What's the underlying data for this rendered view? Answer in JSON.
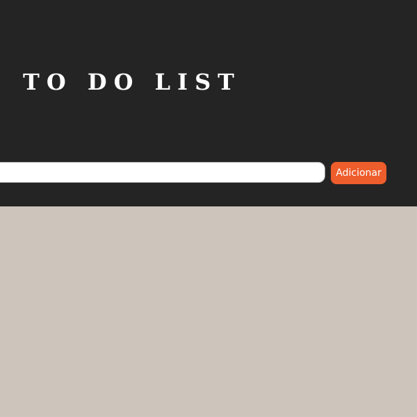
{
  "header": {
    "title": "TO DO LIST"
  },
  "form": {
    "task_input_value": "",
    "task_input_placeholder": "",
    "add_button_label": "Adicionar"
  },
  "tasks": [],
  "colors": {
    "header_background": "#252424",
    "page_background": "#cdc5bb",
    "accent": "#ee5d2c",
    "title_text": "#ffffff"
  }
}
